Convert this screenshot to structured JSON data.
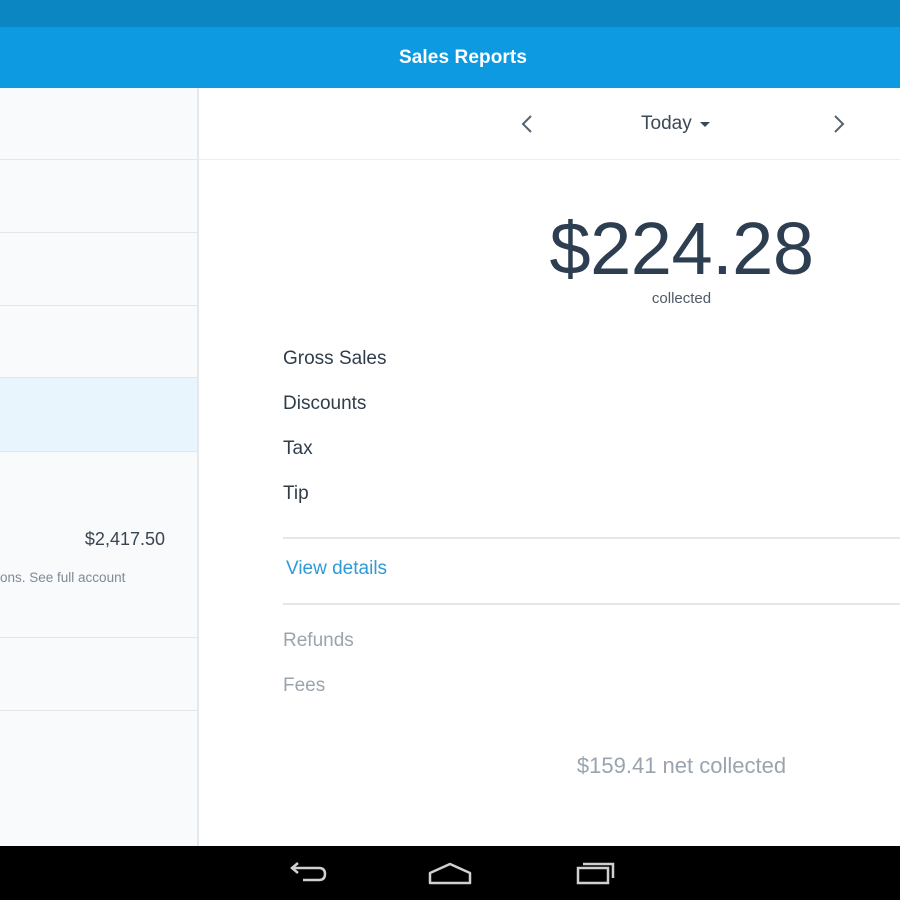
{
  "app_bar": {
    "title": "Sales Reports"
  },
  "sidebar": {
    "account_amount": "$2,417.50",
    "account_note": "ons. See full account"
  },
  "date_nav": {
    "label": "Today",
    "prev_icon": "chevron-left-icon",
    "next_icon": "chevron-right-icon"
  },
  "summary": {
    "amount": "$224.28",
    "caption": "collected"
  },
  "line_items": [
    "Gross Sales",
    "Discounts",
    "Tax",
    "Tip"
  ],
  "view_details_label": "View details",
  "adjustments": [
    "Refunds",
    "Fees"
  ],
  "net_collected": "$159.41 net collected",
  "colors": {
    "status_bar": "#0b86c2",
    "app_bar": "#0d9ae0",
    "accent_link": "#2f9ad8",
    "selected_row": "#e9f5fc"
  },
  "system_nav": {
    "back_icon": "back-icon",
    "home_icon": "home-icon",
    "recents_icon": "recents-icon"
  }
}
